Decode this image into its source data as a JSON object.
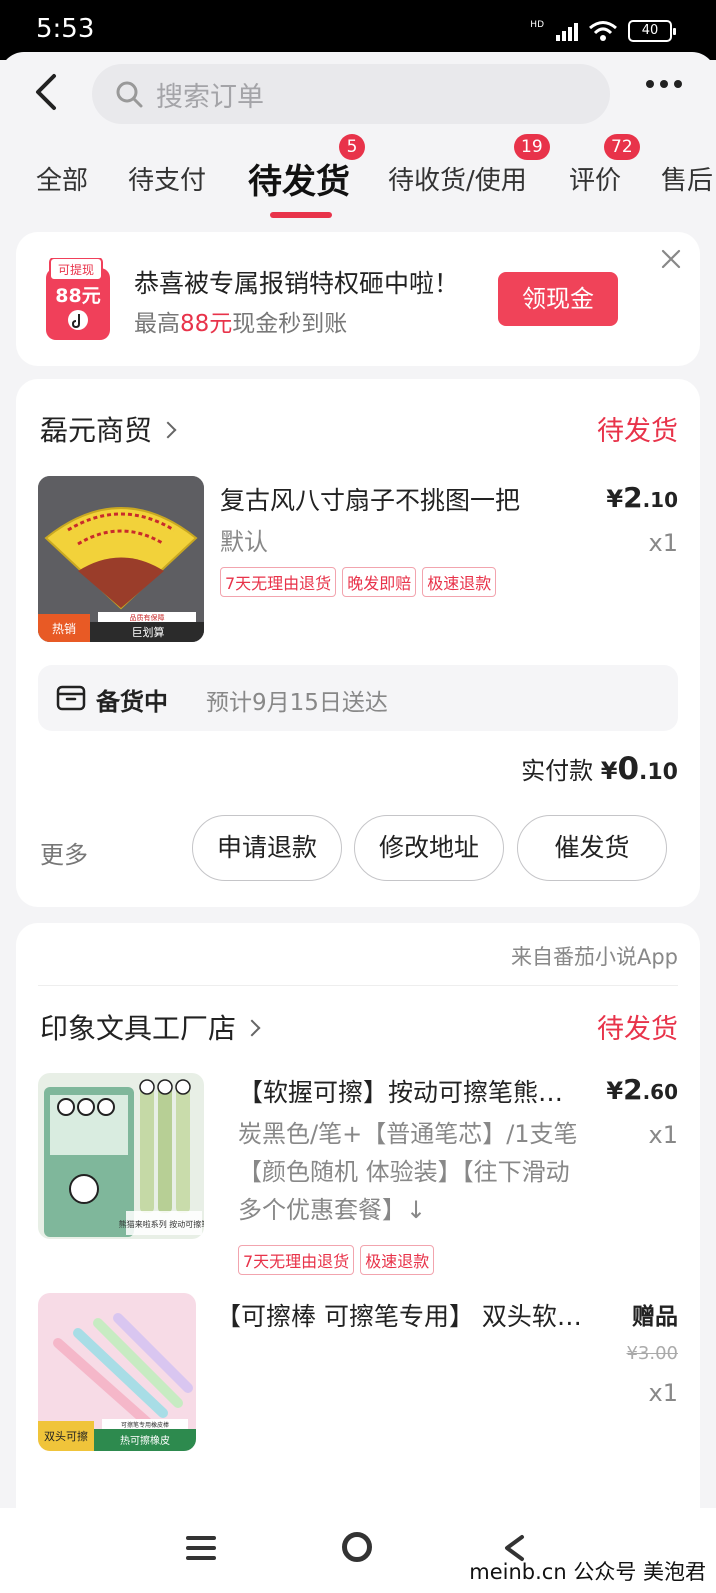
{
  "status_bar": {
    "time": "5:53",
    "hd": "HD",
    "battery": "40"
  },
  "header": {
    "search_placeholder": "搜索订单"
  },
  "tabs": [
    {
      "label": "全部"
    },
    {
      "label": "待支付"
    },
    {
      "label": "待发货",
      "badge": "5"
    },
    {
      "label": "待收货/使用",
      "badge": "19"
    },
    {
      "label": "评价",
      "badge": "72"
    },
    {
      "label": "售后"
    }
  ],
  "promo": {
    "icon_top": "可提现",
    "icon_amount": "88元",
    "title": "恭喜被专属报销特权砸中啦！",
    "sub_prefix": "最高",
    "sub_highlight": "88元",
    "sub_suffix": "现金秒到账",
    "button": "领现金"
  },
  "orders": [
    {
      "shop": "磊元商贸",
      "status": "待发货",
      "product": {
        "title": "复古风八寸扇子不挑图一把",
        "spec": "默认",
        "price_symbol": "¥",
        "price_int": "2",
        "price_dec": ".10",
        "qty": "x1",
        "tags": [
          "7天无理由退货",
          "晚发即赔",
          "极速退款"
        ],
        "image_badge_left": "热销",
        "image_badge_right": "巨划算",
        "image_badge_top": "品质有保障"
      },
      "shipping": {
        "label": "备货中",
        "eta": "预计9月15日送达"
      },
      "paid_label": "实付款",
      "paid_symbol": "¥",
      "paid_int": "0",
      "paid_dec": ".10",
      "more": "更多",
      "buttons": [
        "申请退款",
        "修改地址",
        "催发货"
      ]
    },
    {
      "source": "来自番茄小说App",
      "shop": "印象文具工厂店",
      "status": "待发货",
      "product": {
        "title": "【软握可擦】按动可擦笔熊…",
        "spec_lines": [
          "炭黑色/笔+【普通笔芯】/1支笔",
          "【颜色随机 体验装】【往下滑动",
          "多个优惠套餐】↓"
        ],
        "price_symbol": "¥",
        "price_int": "2",
        "price_dec": ".60",
        "qty": "x1",
        "tags": [
          "7天无理由退货",
          "极速退款"
        ],
        "image_badge": "熊猫来啦系列 按动可擦笔"
      },
      "gift": {
        "title": "【可擦棒 可擦笔专用】 双头软…",
        "label": "赠品",
        "original_price": "¥3.00",
        "qty": "x1",
        "image_badge_left": "双头可擦",
        "image_badge_right": "热可擦橡皮",
        "image_badge_top": "可擦笔专用橡皮棒"
      }
    }
  ],
  "watermark": "meinb.cn  公众号 美泡君",
  "colors": {
    "accent": "#e8334a",
    "page_bg": "#f4f4f6",
    "card_bg": "#ffffff"
  }
}
